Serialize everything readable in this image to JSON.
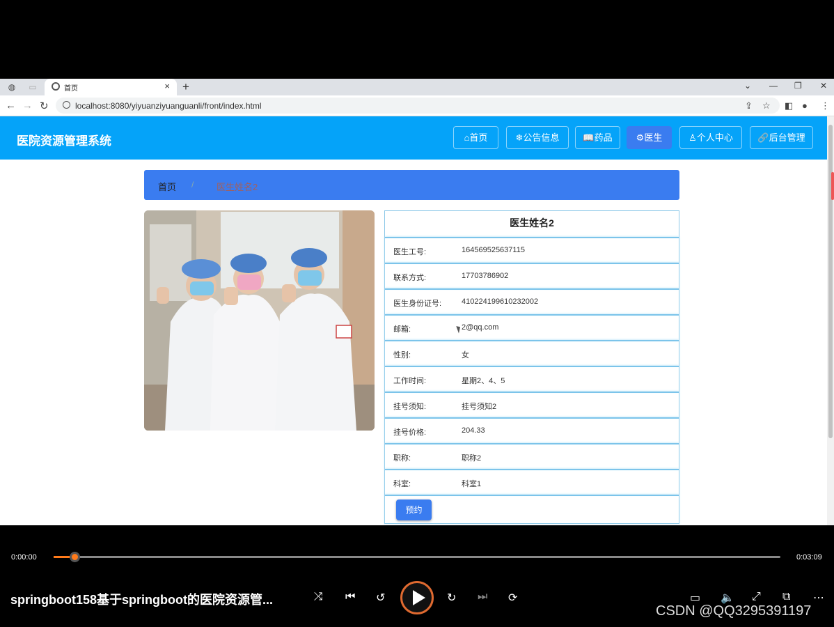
{
  "browser": {
    "tab_title": "首页",
    "url": "localhost:8080/yiyuanziyuanguanli/front/index.html"
  },
  "site": {
    "logo": "医院资源管理系统",
    "nav": [
      {
        "label": "首页",
        "icon": "home-icon"
      },
      {
        "label": "公告信息",
        "icon": "snowflake-icon"
      },
      {
        "label": "药品",
        "icon": "book-icon"
      },
      {
        "label": "医生",
        "icon": "gear-icon"
      },
      {
        "label": "个人中心",
        "icon": "user-icon"
      },
      {
        "label": "后台管理",
        "icon": "link-icon"
      }
    ],
    "active_nav": "医生"
  },
  "breadcrumb": {
    "home": "首页",
    "separator": "/",
    "current": "医生姓名2"
  },
  "doctor": {
    "name": "医生姓名2",
    "fields": [
      {
        "label": "医生工号:",
        "value": "164569525637115"
      },
      {
        "label": "联系方式:",
        "value": "17703786902"
      },
      {
        "label": "医生身份证号:",
        "value": "410224199610232002"
      },
      {
        "label": "邮箱:",
        "value": "2@qq.com"
      },
      {
        "label": "性别:",
        "value": "女"
      },
      {
        "label": "工作时间:",
        "value": "星期2、4、5"
      },
      {
        "label": "挂号须知:",
        "value": "挂号须知2"
      },
      {
        "label": "挂号价格:",
        "value": "204.33"
      },
      {
        "label": "职称:",
        "value": "职称2"
      },
      {
        "label": "科室:",
        "value": "科室1"
      }
    ],
    "book_label": "预约"
  },
  "player": {
    "current_time": "0:00:00",
    "total_time": "0:03:09",
    "progress": 0.03,
    "title": "springboot158基于springboot的医院资源管...",
    "watermark": "CSDN @QQ3295391197"
  },
  "colors": {
    "header": "#05a3f9",
    "accent": "#3a7cf0",
    "progress": "#ff7a1a"
  }
}
